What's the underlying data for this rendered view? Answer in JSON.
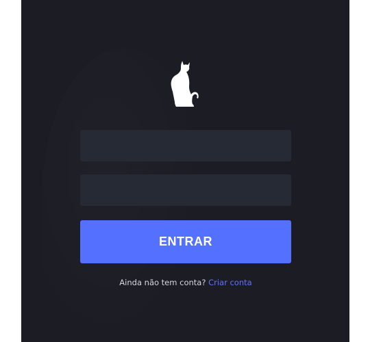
{
  "login": {
    "logo_icon": "cat-silhouette-icon",
    "username": {
      "value": "",
      "placeholder": ""
    },
    "password": {
      "value": "",
      "placeholder": ""
    },
    "submit_label": "ENTRAR",
    "signup_prompt": "Ainda não tem conta?",
    "signup_link": "Criar conta"
  },
  "colors": {
    "background": "#1c1c24",
    "input": "#262a34",
    "accent": "#5470ff",
    "link": "#6272ff"
  }
}
